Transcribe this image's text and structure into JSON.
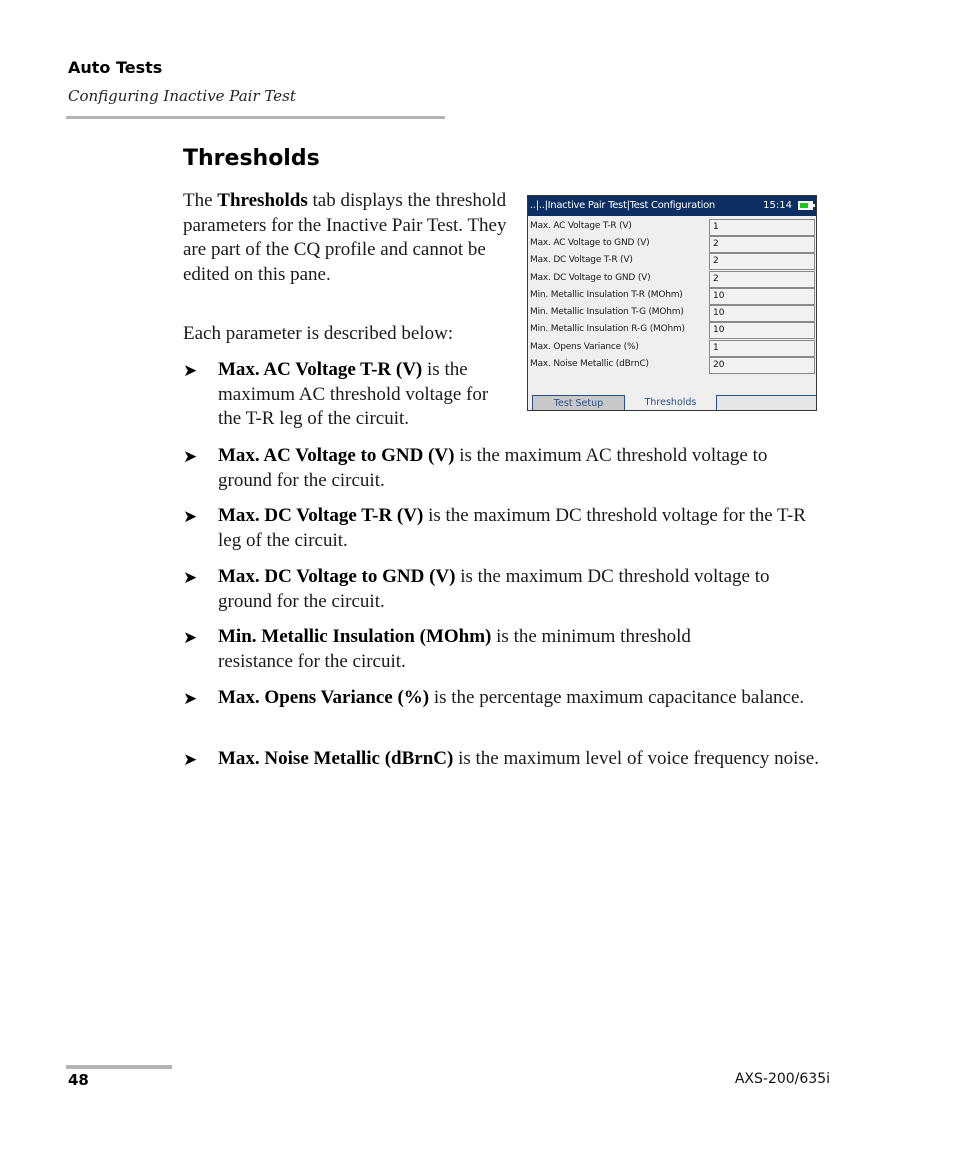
{
  "running_head": {
    "title": "Auto Tests",
    "subtitle": "Configuring Inactive Pair Test"
  },
  "section": {
    "title": "Thresholds",
    "intro": {
      "pre": "The ",
      "bold": "Thresholds",
      "post": " tab displays the threshold parameters for the Inactive Pair Test. They are part of the CQ profile and cannot be edited on this pane."
    },
    "each_param": "Each parameter is described below:"
  },
  "bullets": [
    {
      "bold": "Max. AC Voltage T-R (V)",
      "text": " is the maximum AC threshold voltage for the T-R leg of the circuit."
    },
    {
      "bold": "Max. AC Voltage to GND (V)",
      "text": " is the maximum AC threshold voltage to ground for the circuit."
    },
    {
      "bold": "Max. DC Voltage T-R (V)",
      "text": " is the maximum DC threshold voltage for the T-R leg of the circuit."
    },
    {
      "bold": "Max. DC Voltage to GND (V)",
      "text": " is the maximum DC threshold voltage to ground for the circuit."
    },
    {
      "bold": "Min. Metallic Insulation (MOhm)",
      "text": " is the minimum threshold resistance for the circuit."
    },
    {
      "bold": "Max. Opens Variance (%)",
      "text": " is the percentage maximum capacitance balance."
    },
    {
      "bold": "Max. Noise Metallic (dBrnC)",
      "text": " is the maximum level of voice frequency noise."
    }
  ],
  "bullet_glyph": "➤",
  "device": {
    "breadcrumb": "..|..|Inactive Pair Test|Test Configuration",
    "clock": "15:14",
    "battery_icon": "battery-charging-icon",
    "rows": [
      {
        "label": "Max. AC Voltage T-R (V)",
        "value": "1"
      },
      {
        "label": "Max. AC Voltage to GND (V)",
        "value": "2"
      },
      {
        "label": "Max. DC Voltage T-R (V)",
        "value": "2"
      },
      {
        "label": "Max. DC Voltage to GND (V)",
        "value": "2"
      },
      {
        "label": "Min. Metallic Insulation T-R (MOhm)",
        "value": "10"
      },
      {
        "label": "Min. Metallic Insulation T-G (MOhm)",
        "value": "10"
      },
      {
        "label": "Min. Metallic Insulation R-G (MOhm)",
        "value": "10"
      },
      {
        "label": "Max. Opens Variance (%)",
        "value": "1"
      },
      {
        "label": "Max. Noise Metallic (dBrnC)",
        "value": "20"
      }
    ],
    "tabs": [
      {
        "label": "Test Setup",
        "active": false
      },
      {
        "label": "Thresholds",
        "active": true
      }
    ],
    "colors": {
      "titlebar": "#0b2e63",
      "tab_text": "#2a4f8a",
      "battery": "#21c421"
    }
  },
  "footer": {
    "page_number": "48",
    "product": "AXS-200/635i"
  }
}
